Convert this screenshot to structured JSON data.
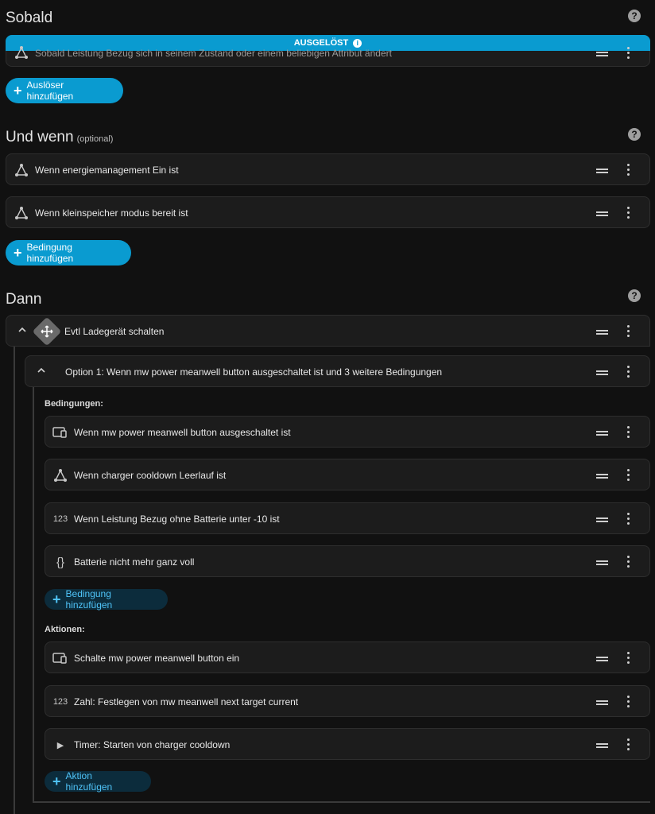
{
  "trigger_section": {
    "title": "Sobald",
    "help": "?",
    "banner": "AUSGELÖST",
    "banner_info": "i",
    "trigger_text": "Sobald Leistung Bezug sich in seinem Zustand oder einem beliebigen Attribut ändert",
    "add_label": "Auslöser hinzufügen"
  },
  "condition_section": {
    "title": "Und wenn",
    "optional": "(optional)",
    "help": "?",
    "items": [
      {
        "icon": "state-icon",
        "label": "Wenn energiemanagement Ein ist"
      },
      {
        "icon": "state-icon",
        "label": "Wenn kleinspeicher modus bereit ist"
      }
    ],
    "add_label": "Bedingung hinzufügen"
  },
  "action_section": {
    "title": "Dann",
    "help": "?",
    "choose_label": "Evtl Ladegerät schalten",
    "option_label": "Option 1: Wenn mw power meanwell button ausgeschaltet ist und 3 weitere Bedingungen",
    "conditions_heading": "Bedingungen:",
    "conditions": [
      {
        "icon": "device-icon",
        "glyph": "",
        "label": "Wenn mw power meanwell button ausgeschaltet ist"
      },
      {
        "icon": "state-icon",
        "glyph": "",
        "label": "Wenn charger cooldown Leerlauf ist"
      },
      {
        "icon": "numeric-icon",
        "glyph": "123",
        "label": "Wenn Leistung Bezug ohne Batterie unter -10 ist"
      },
      {
        "icon": "template-icon",
        "glyph": "{}",
        "label": "Batterie nicht mehr ganz voll"
      }
    ],
    "add_condition_label": "Bedingung hinzufügen",
    "actions_heading": "Aktionen:",
    "actions": [
      {
        "icon": "device-icon",
        "glyph": "",
        "label": "Schalte mw power meanwell button ein"
      },
      {
        "icon": "numeric-icon",
        "glyph": "123",
        "label": "Zahl: Festlegen von mw meanwell next target current"
      },
      {
        "icon": "play-icon",
        "glyph": "▶",
        "label": "Timer: Starten von charger cooldown"
      }
    ],
    "add_action_label": "Aktion hinzufügen"
  },
  "colors": {
    "accent": "#0a9bd0",
    "background": "#111111",
    "card": "#1c1c1c"
  }
}
